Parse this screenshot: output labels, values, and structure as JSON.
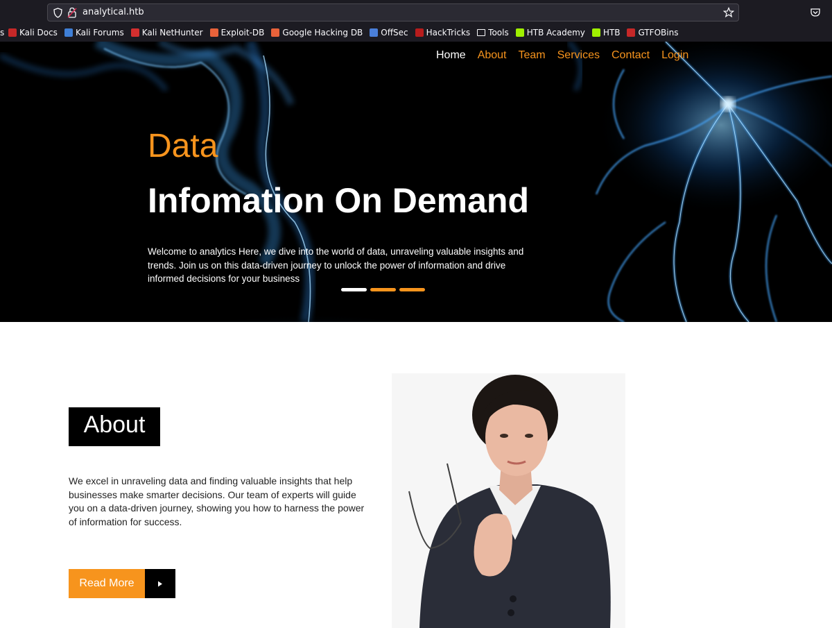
{
  "browser": {
    "url": "analytical.htb",
    "bookmarks": [
      {
        "label": "Kali Docs",
        "icon": "kali-docs-icon",
        "color": "#c62828"
      },
      {
        "label": "Kali Forums",
        "icon": "kali-forums-icon",
        "color": "#3f7fd6"
      },
      {
        "label": "Kali NetHunter",
        "icon": "kali-nethunter-icon",
        "color": "#d32f2f"
      },
      {
        "label": "Exploit-DB",
        "icon": "exploit-db-icon",
        "color": "#e8623a"
      },
      {
        "label": "Google Hacking DB",
        "icon": "ghdb-icon",
        "color": "#e8623a"
      },
      {
        "label": "OffSec",
        "icon": "offsec-icon",
        "color": "#4a7fd9"
      },
      {
        "label": "HackTricks",
        "icon": "hacktricks-icon",
        "color": "#b71c1c"
      },
      {
        "label": "Tools",
        "icon": "folder-icon",
        "color": "#fbfbfe"
      },
      {
        "label": "HTB Academy",
        "icon": "htb-academy-icon",
        "color": "#9fef00"
      },
      {
        "label": "HTB",
        "icon": "htb-icon",
        "color": "#9fef00"
      },
      {
        "label": "GTFOBins",
        "icon": "gtfobins-icon",
        "color": "#c62828"
      }
    ]
  },
  "nav": {
    "items": [
      {
        "label": "Home",
        "active": true
      },
      {
        "label": "About",
        "active": false
      },
      {
        "label": "Team",
        "active": false
      },
      {
        "label": "Services",
        "active": false
      },
      {
        "label": "Contact",
        "active": false
      },
      {
        "label": "Login",
        "active": false
      }
    ]
  },
  "hero": {
    "kicker": "Data",
    "title": "Infomation On Demand",
    "text": "Welcome to analytics Here, we dive into the world of data, unraveling valuable insights and trends. Join us on this data-driven journey to unlock the power of information and drive informed decisions for your business",
    "slides": 3,
    "active_slide": 1
  },
  "about": {
    "title": "About",
    "text": "We excel in unraveling data and finding valuable insights that help businesses make smarter decisions. Our team of experts will guide you on a data-driven journey, showing you how to harness the power of information for success.",
    "read_more": "Read More"
  },
  "colors": {
    "accent": "#f7941d",
    "hero_bg": "#000000",
    "glow": "#2b8fe8"
  }
}
